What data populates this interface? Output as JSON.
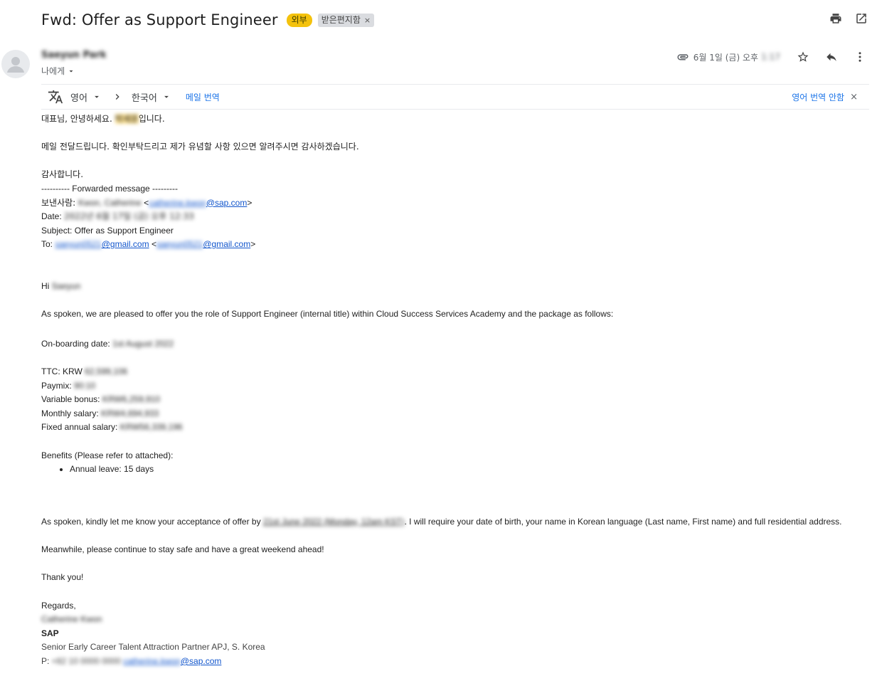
{
  "subject": "Fwd: Offer as Support Engineer",
  "labels": {
    "external": "외부",
    "inbox": "받은편지함",
    "inbox_close": "×"
  },
  "header_icons": {
    "print": "print-icon",
    "open_new": "open-in-new-window-icon"
  },
  "sender": {
    "name": "Saeyun Park",
    "recipient_label": "나에게"
  },
  "meta": {
    "date_text": "6월 1일 (금) 오후",
    "time_text": "1:17"
  },
  "translate": {
    "from_lang": "영어",
    "to_lang": "한국어",
    "translate_link": "메일 번역",
    "dont_translate": "영어 번역 안함",
    "close": "×"
  },
  "body": {
    "greeting_ko_a": "대표님, 안녕하세요. ",
    "greeting_ko_name": "박세윤",
    "greeting_ko_b": "입니다.",
    "forward_note": "메일 전달드립니다. 확인부탁드리고 제가 유념할 사항 있으면 알려주시면 감사하겠습니다.",
    "thanks_ko": "감사합니다.",
    "fwd_header": "---------- Forwarded message ---------",
    "from_label": "보낸사람: ",
    "from_name": "Kwon, Catherine",
    "from_email_blur": "catherine.kwon",
    "from_email_domain": "@sap.com",
    "date_label": "Date: ",
    "date_value": "2022년 6월 17일 (금) 오후 12:33",
    "subject_line": "Subject: Offer as Support Engineer",
    "to_label": "To: ",
    "to_email1_blur": "saeyun0521",
    "to_email1_domain": "@gmail.com",
    "to_email2_blur": "saeyun0521",
    "to_email2_domain": "@gmail.com",
    "hi": "Hi ",
    "hi_name": "Saeyun",
    "intro": "As spoken, we are pleased to offer you the role of Support Engineer (internal title) within Cloud Success Services Academy and the package as follows:",
    "onboarding_label": "On-boarding date: ",
    "onboarding_value": "1st August 2022",
    "ttc_label": "TTC: KRW ",
    "ttc_value": "62,599,106",
    "paymix_label": "Paymix: ",
    "paymix_value": "90:10",
    "variable_label": "Variable bonus: ",
    "variable_value": "KRW6,259,910",
    "monthly_label": "Monthly salary: ",
    "monthly_value": "KRW4,694,933",
    "fixed_label": "Fixed annual salary: ",
    "fixed_value": "KRW56,339,196",
    "benefits_label": "Benefits (Please refer to attached):",
    "benefit_1": "Annual leave: 15 days",
    "accept_a": "As spoken, kindly let me know your acceptance of offer by ",
    "accept_deadline": "21st June 2022 (Monday, 12am KST)",
    "accept_b": ". I will require your date of birth, your name in Korean language (Last name, First name) and full residential address.",
    "meanwhile": "Meanwhile, please continue to stay safe and have a great weekend ahead!",
    "thank_you": "Thank you!",
    "regards": "Regards,",
    "sig_name": "Catherine Kwon",
    "sig_company": "SAP",
    "sig_title": "Senior Early Career Talent Attraction Partner APJ, S. Korea",
    "sig_phone_label": "P: ",
    "sig_phone": "+82 10 0000 0000",
    "sig_email_blur": "catherine.kwon",
    "sig_email_domain": "@sap.com"
  }
}
